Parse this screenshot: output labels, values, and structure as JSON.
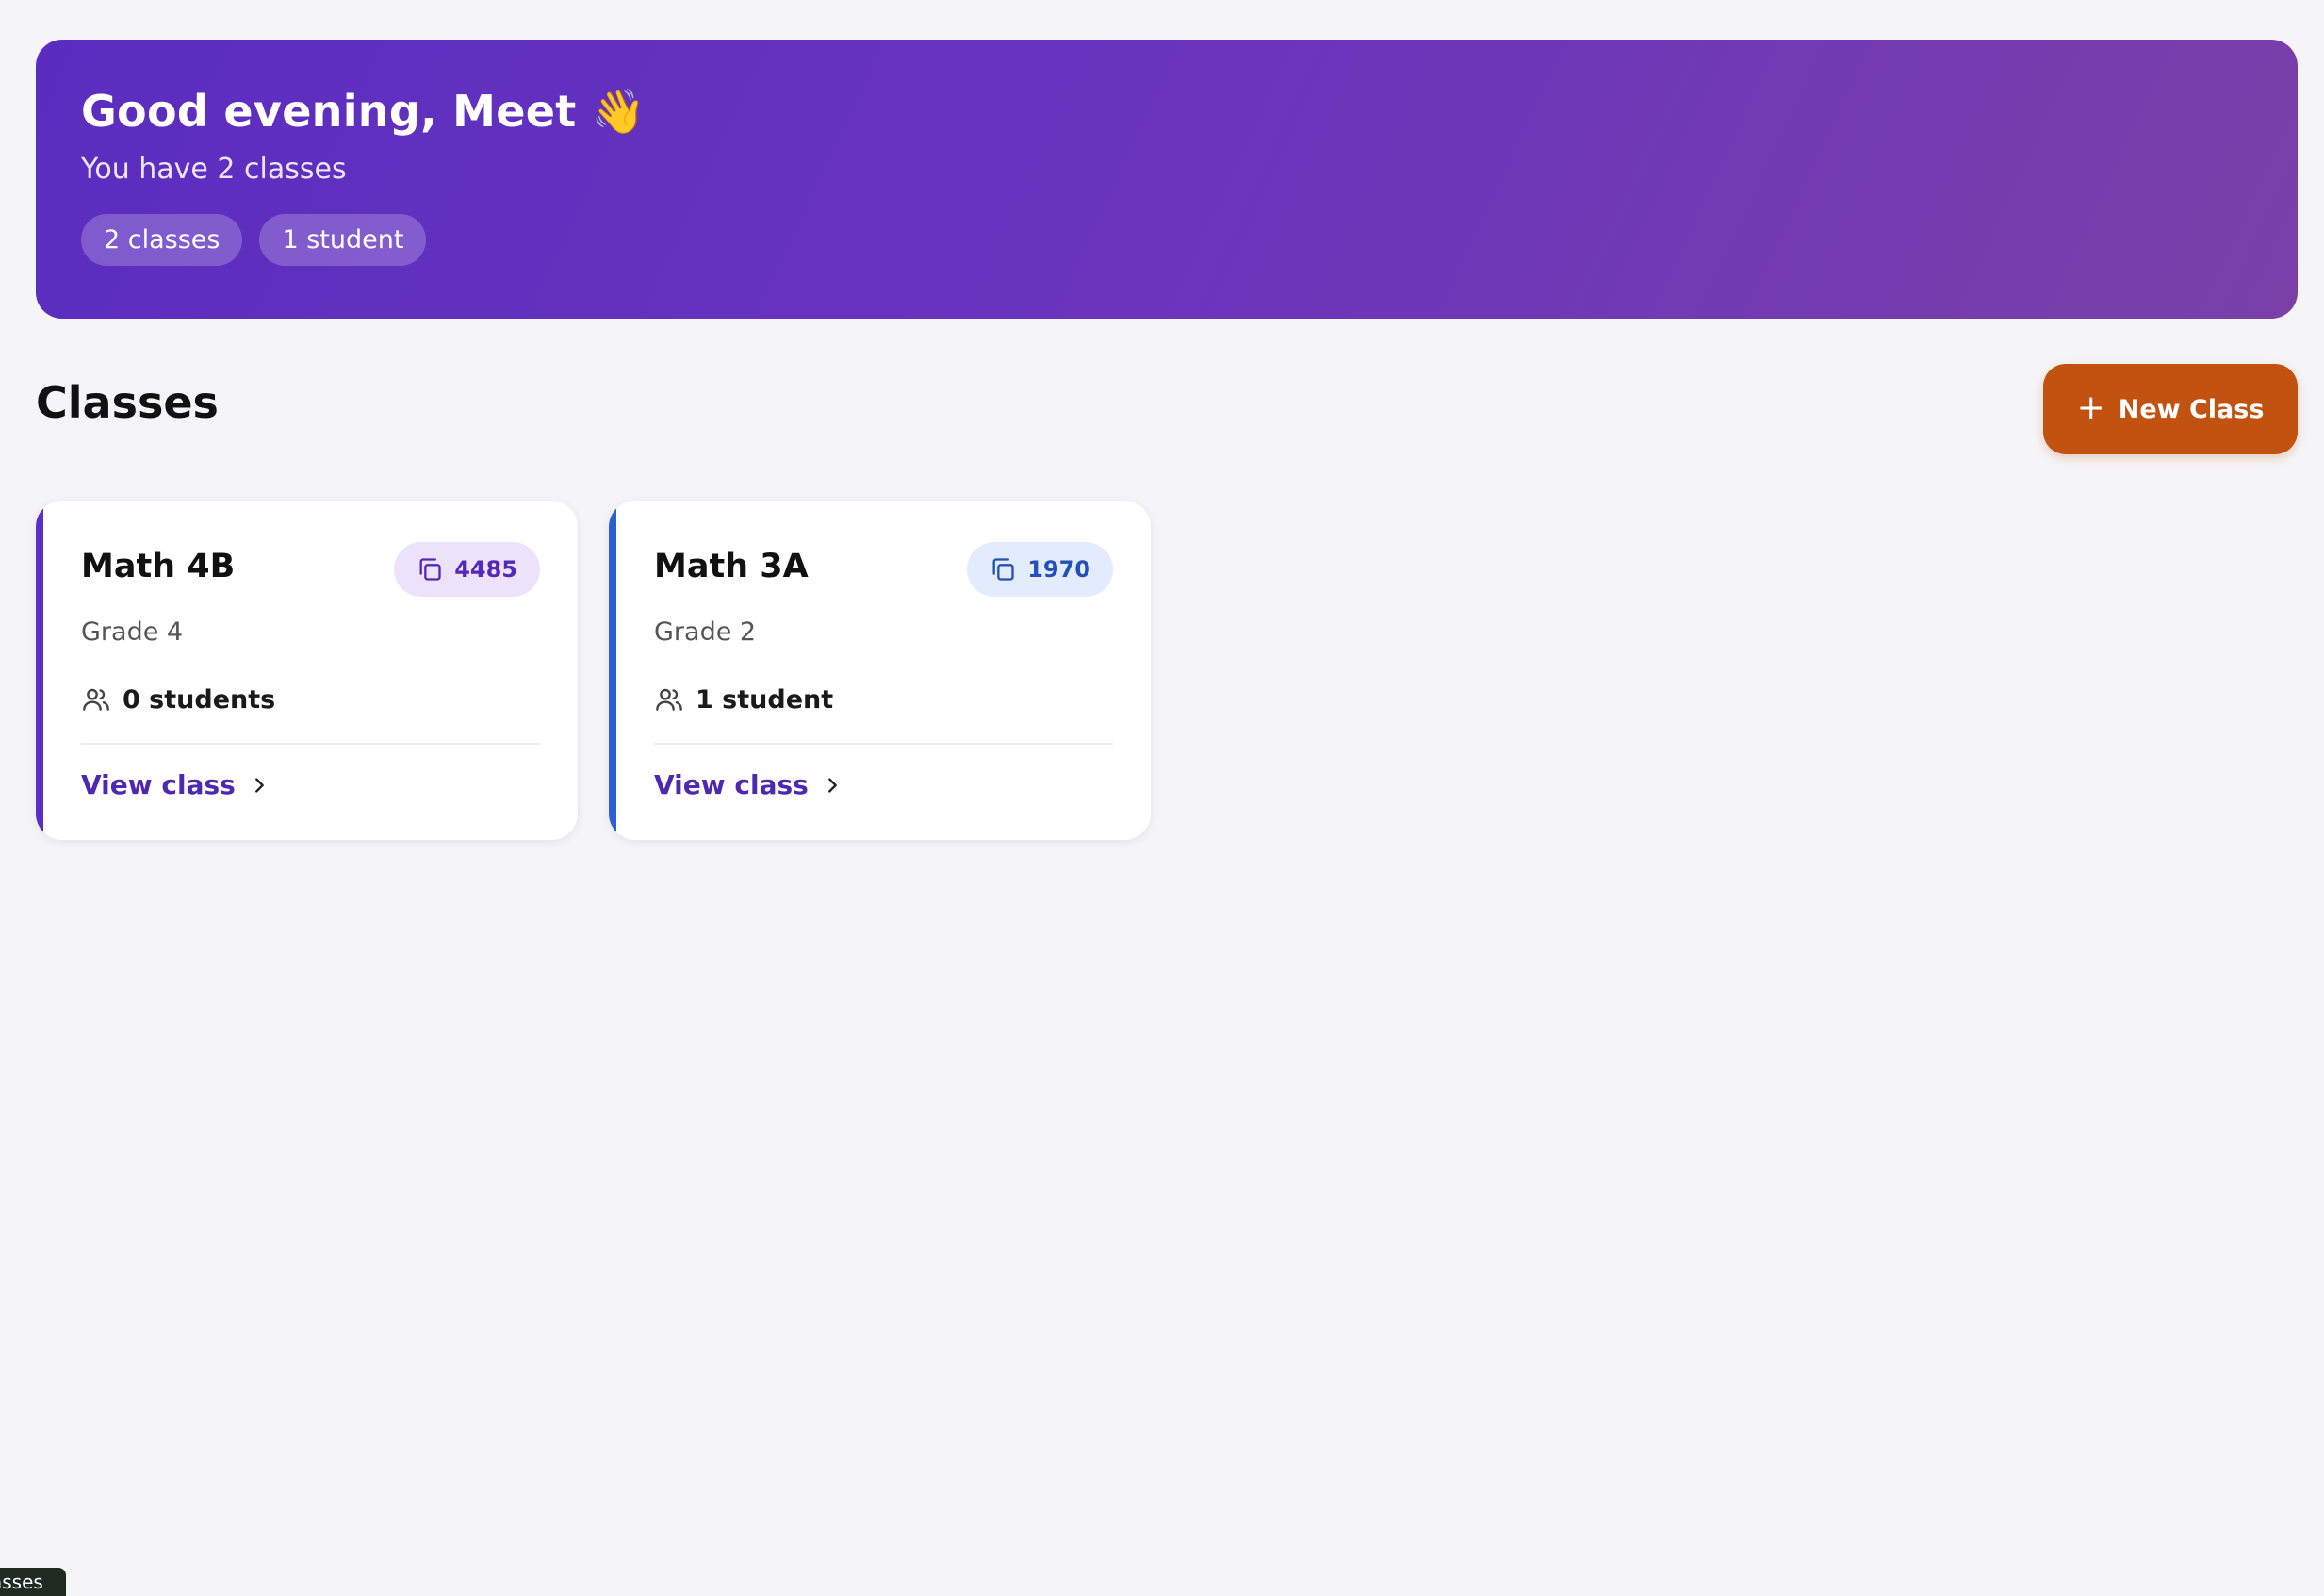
{
  "hero": {
    "greeting": "Good evening, Meet",
    "wave_emoji": "👋",
    "subtitle": "You have 2 classes",
    "pills": [
      "2 classes",
      "1 student"
    ]
  },
  "section": {
    "title": "Classes",
    "new_button_label": "New Class"
  },
  "classes": [
    {
      "name": "Math 4B",
      "code": "4485",
      "grade": "Grade 4",
      "students": "0 students",
      "view_label": "View class",
      "accent": "#5b2fc6"
    },
    {
      "name": "Math 3A",
      "code": "1970",
      "grade": "Grade 2",
      "students": "1 student",
      "view_label": "View class",
      "accent": "#2c5fd0"
    }
  ],
  "colors": {
    "hero_gradient_start": "#5a2dc0",
    "hero_gradient_end": "#7a40a8",
    "new_button": "#c2520f",
    "background": "#f5f5f7"
  },
  "footer_tag": "asses"
}
